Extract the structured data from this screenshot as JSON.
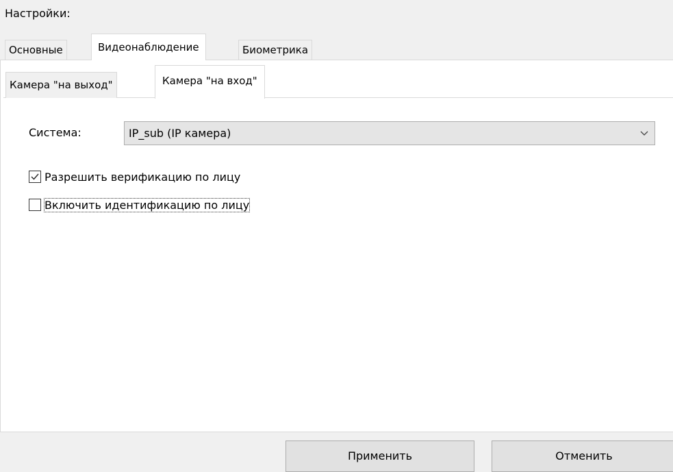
{
  "settings_label": "Настройки:",
  "outer_tabs": [
    {
      "label": "Основные",
      "active": false
    },
    {
      "label": "Видеонаблюдение",
      "active": true
    },
    {
      "label": "Биометрика",
      "active": false
    }
  ],
  "inner_tabs": [
    {
      "label": "Камера \"на выход\"",
      "active": false
    },
    {
      "label": "Камера \"на вход\"",
      "active": true
    }
  ],
  "system": {
    "label": "Система:",
    "value": "IP_sub (IP камера)",
    "dropdown_icon": "chevron-down-icon"
  },
  "checkboxes": [
    {
      "label": "Разрешить верификацию по лицу",
      "checked": true
    },
    {
      "label": "Включить идентификацию по лицу",
      "checked": false
    }
  ],
  "buttons": {
    "apply": "Применить",
    "cancel": "Отменить"
  }
}
